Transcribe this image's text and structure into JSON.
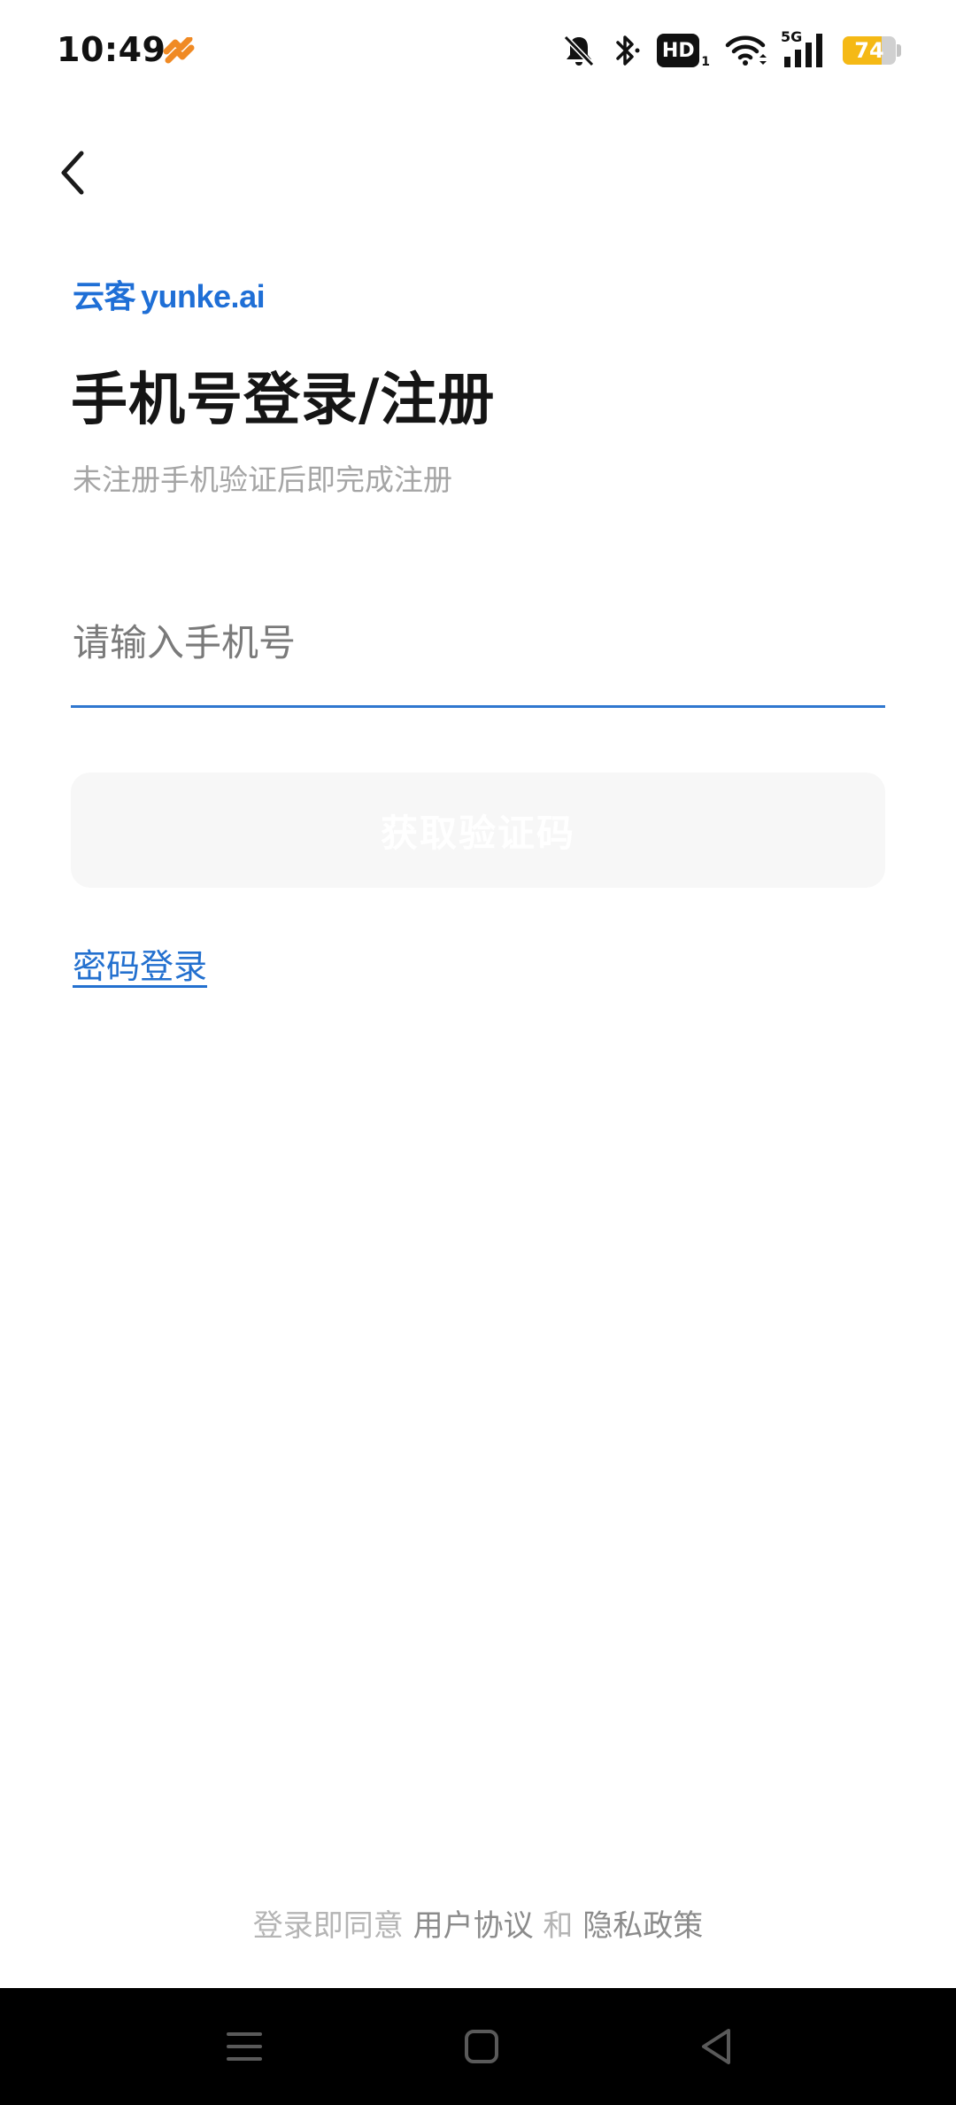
{
  "status_bar": {
    "time": "10:49",
    "network_label": "5G",
    "hd_label": "HD",
    "hd_sub": "1",
    "battery_level": 74,
    "battery_text": "74",
    "battery_color": "#f5b915"
  },
  "header": {
    "back_icon": "chevron-left-icon"
  },
  "logo": {
    "cn": "云客",
    "en": "yunke.ai",
    "color": "#1f6fd6"
  },
  "page": {
    "title": "手机号登录/注册",
    "subtitle": "未注册手机验证后即完成注册"
  },
  "form": {
    "phone_placeholder": "请输入手机号",
    "phone_value": "",
    "get_code_label": "获取验证码",
    "accent_color": "#2f77cf"
  },
  "links": {
    "password_login": "密码登录"
  },
  "agreement": {
    "prefix": "登录即同意",
    "user_agreement": "用户协议",
    "and": "和",
    "privacy_policy": "隐私政策"
  },
  "nav": {
    "menu_icon": "menu-icon",
    "home_icon": "home-icon",
    "back_icon": "back-triangle-icon"
  }
}
